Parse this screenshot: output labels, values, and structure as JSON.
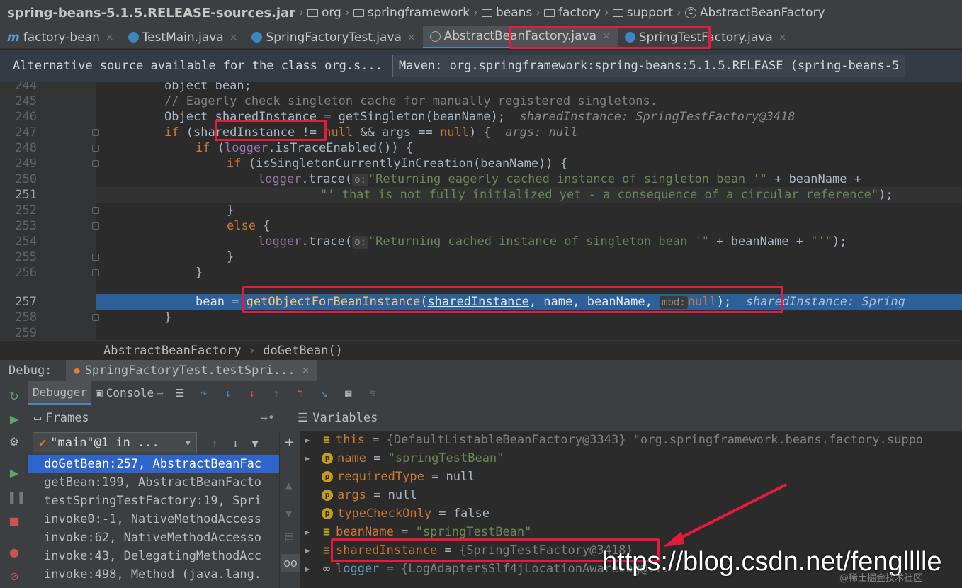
{
  "breadcrumb": {
    "items": [
      "spring-beans-5.1.5.RELEASE-sources.jar",
      "org",
      "springframework",
      "beans",
      "factory",
      "support",
      "AbstractBeanFactory"
    ]
  },
  "tabs": [
    {
      "label": "factory-bean",
      "icon": "module-icon"
    },
    {
      "label": "TestMain.java",
      "icon": "class-icon"
    },
    {
      "label": "SpringFactoryTest.java",
      "icon": "class-icon"
    },
    {
      "label": "AbstractBeanFactory.java",
      "icon": "abstract-class-icon",
      "active": true
    },
    {
      "label": "SpringTestFactory.java",
      "icon": "class-icon"
    }
  ],
  "alt_source": {
    "message": "Alternative source available for the class org.s...",
    "selected": "Maven: org.springframework:spring-beans:5.1.5.RELEASE (spring-beans-5"
  },
  "editor": {
    "line_numbers": [
      "244",
      "245",
      "246",
      "247",
      "248",
      "249",
      "250",
      "251",
      "252",
      "253",
      "254",
      "255",
      "256",
      "257",
      "258",
      "259"
    ],
    "l244": "object bean;",
    "l245": "// Eagerly check singleton cache for manually registered singletons.",
    "l246_a": "Object ",
    "l246_var": "sharedInstance",
    "l246_b": " = getSingleton(beanName);",
    "l246_hint": "sharedInstance: SpringTestFactory@3418",
    "l247_if": "if",
    "l247_a": " (",
    "l247_var": "sharedInstance",
    "l247_b": " != ",
    "l247_null": "null",
    "l247_c": " && args == ",
    "l247_null2": "null",
    "l247_d": ") {",
    "l247_hint": "args: null",
    "l248_if": "if",
    "l248_a": " (",
    "l248_logger": "logger",
    "l248_b": ".isTraceEnabled()) {",
    "l249_if": "if",
    "l249_a": " (isSingletonCurrentlyInCreation(beanName)) {",
    "l250_logger": "logger",
    "l250_a": ".trace(",
    "l250_ph": "o:",
    "l250_str": "\"Returning eagerly cached instance of singleton bean '\"",
    "l250_b": " + beanName +",
    "l251_str": "\"' that is not fully initialized yet - a consequence of a circular reference\"",
    "l251_b": ");",
    "l252": "}",
    "l253_else": "else",
    "l253_b": " {",
    "l254_logger": "logger",
    "l254_a": ".trace(",
    "l254_ph": "o:",
    "l254_str": "\"Returning cached instance of singleton bean '\"",
    "l254_b": " + beanName + ",
    "l254_str2": "\"'\"",
    "l254_c": ");",
    "l255": "}",
    "l256": "}",
    "l257_a": "bean = ",
    "l257_fn": "getObjectForBeanInstance(",
    "l257_var": "sharedInstance",
    "l257_b": ", name, beanName, ",
    "l257_ph": "mbd:",
    "l257_null": "null",
    "l257_c": ");",
    "l257_hint": "sharedInstance: Spring",
    "l258": "}"
  },
  "navbar": {
    "class": "AbstractBeanFactory",
    "method": "doGetBean()"
  },
  "debug": {
    "label": "Debug:",
    "session": "SpringFactoryTest.testSpri..."
  },
  "subtabs": {
    "debugger": "Debugger",
    "console": "Console"
  },
  "frames": {
    "title": "Frames",
    "thread": "\"main\"@1 in ...",
    "items": [
      "doGetBean:257, AbstractBeanFac",
      "getBean:199, AbstractBeanFacto",
      "testSpringTestFactory:19, Spri",
      "invoke0:-1, NativeMethodAccess",
      "invoke:62, NativeMethodAccesso",
      "invoke:43, DelegatingMethodAcc",
      "invoke:498, Method (java.lang."
    ]
  },
  "variables": {
    "title": "Variables",
    "items": [
      {
        "name": "this",
        "eq": " = ",
        "value": "{DefaultListableBeanFactory@3343} \"org.springframework.beans.factory.suppo"
      },
      {
        "name": "name",
        "eq": " = ",
        "value": "\"springTestBean\""
      },
      {
        "name": "requiredType",
        "eq": " = ",
        "value": "null"
      },
      {
        "name": "args",
        "eq": " = ",
        "value": "null"
      },
      {
        "name": "typeCheckOnly",
        "eq": " = ",
        "value": "false"
      },
      {
        "name": "beanName",
        "eq": " = ",
        "value": "\"springTestBean\""
      },
      {
        "name": "sharedInstance",
        "eq": " = ",
        "value": "{SpringTestFactory@3418}"
      },
      {
        "name": "logger",
        "eq": " = ",
        "value": "{LogAdapter$Slf4jLocationAwareLog@..."
      }
    ]
  },
  "watermark": {
    "main": "https://blog.csdn.net/fenglllle",
    "sub": "@稀土掘金技术社区"
  },
  "colors": {
    "highlight": "#e8193c",
    "selection": "#2d6099",
    "frame_selected": "#2f65ca"
  }
}
